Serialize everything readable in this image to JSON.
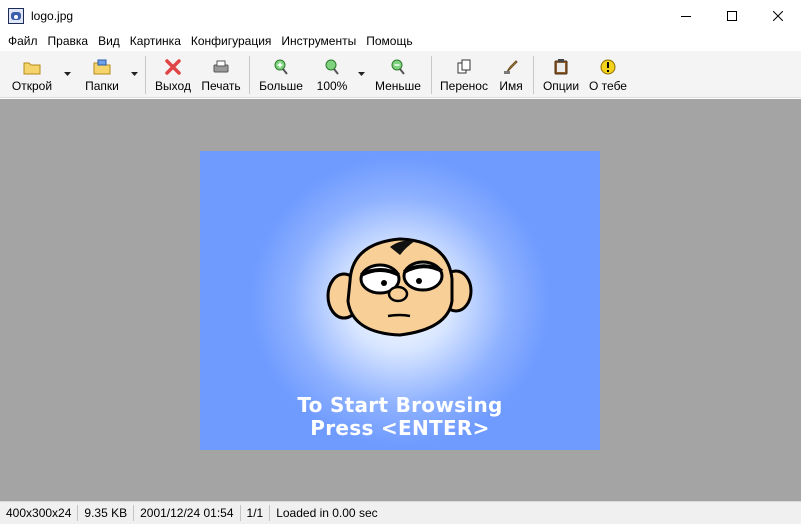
{
  "window": {
    "title": "logo.jpg"
  },
  "menu": [
    "Файл",
    "Правка",
    "Вид",
    "Картинка",
    "Конфигурация",
    "Инструменты",
    "Помощь"
  ],
  "toolbar": {
    "open": "Открой",
    "folders": "Папки",
    "exit": "Выход",
    "print": "Печать",
    "zoom_in": "Больше",
    "zoom_level": "100%",
    "zoom_out": "Меньше",
    "move": "Перенос",
    "name": "Имя",
    "options": "Опции",
    "about": "О тебе"
  },
  "image": {
    "caption_line1": "To Start Browsing",
    "caption_line2": "Press <ENTER>",
    "background_color": "#6f9bff"
  },
  "status": {
    "dimensions": "400x300x24",
    "size": "9.35 KB",
    "date": "2001/12/24 01:54",
    "index": "1/1",
    "load_time": "Loaded in 0.00 sec"
  }
}
